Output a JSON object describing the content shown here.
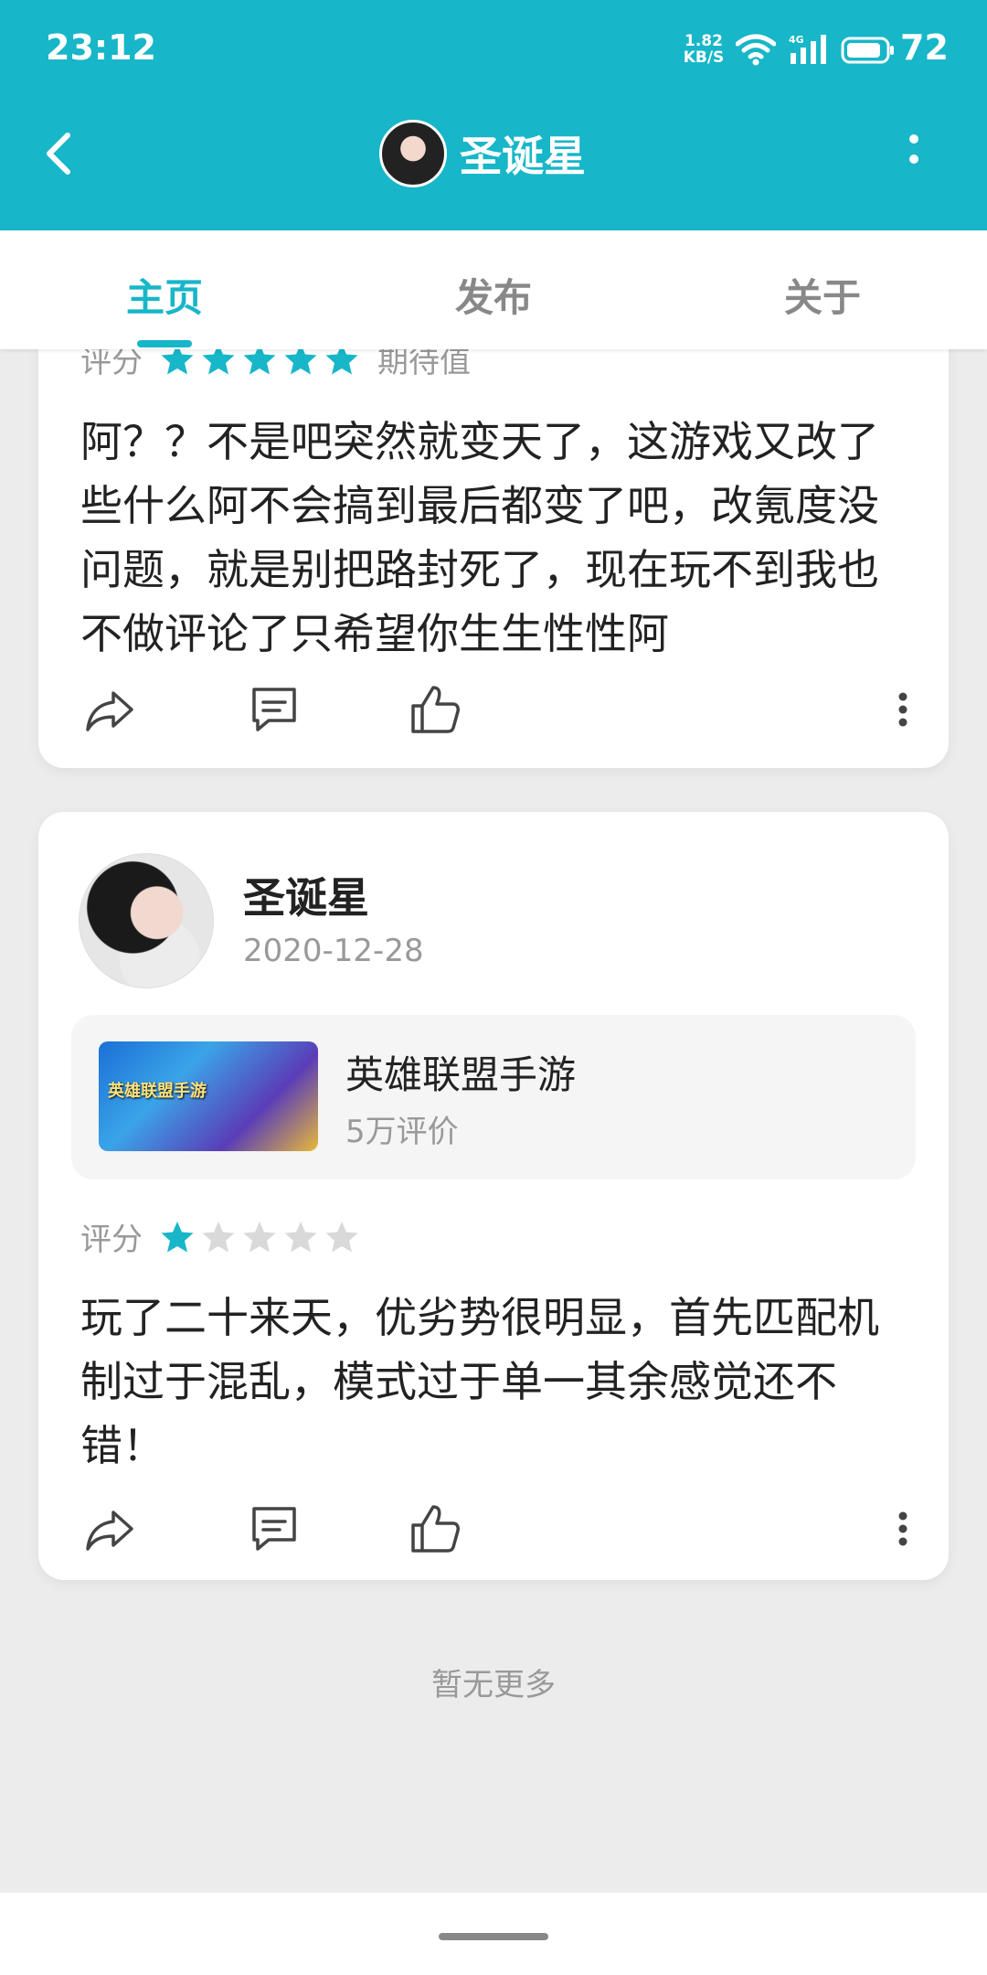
{
  "status_bar": {
    "time": "23:12",
    "network_speed": "1.82\nKB/S",
    "network_type": "4G",
    "battery": "72"
  },
  "app_bar": {
    "title": "圣诞星",
    "back_icon": "back-arrow-icon",
    "more_icon": "more-vertical-icon"
  },
  "tabs": [
    {
      "label": "主页",
      "active": true
    },
    {
      "label": "发布",
      "active": false
    },
    {
      "label": "关于",
      "active": false
    }
  ],
  "posts": [
    {
      "rating_label": "评分",
      "rating": 5,
      "rating_note": "期待值",
      "text": "阿？？不是吧突然就变天了，这游戏又改了些什么阿不会搞到最后都变了吧，改氪度没问题，就是别把路封死了，现在玩不到我也不做评论了只希望你生生性性阿"
    },
    {
      "author": "圣诞星",
      "date": "2020-12-28",
      "game": {
        "name": "英雄联盟手游",
        "reviews": "5万评价",
        "thumb_text": "英雄联盟手游"
      },
      "rating_label": "评分",
      "rating": 1,
      "text": "玩了二十来天，优劣势很明显，首先匹配机制过于混乱，模式过于单一其余感觉还不错！"
    }
  ],
  "footer": {
    "end_note": "暂无更多"
  },
  "colors": {
    "accent": "#17b6c8",
    "star_active": "#17b6c8",
    "star_inactive": "#d9d9d9",
    "background": "#ececec"
  }
}
